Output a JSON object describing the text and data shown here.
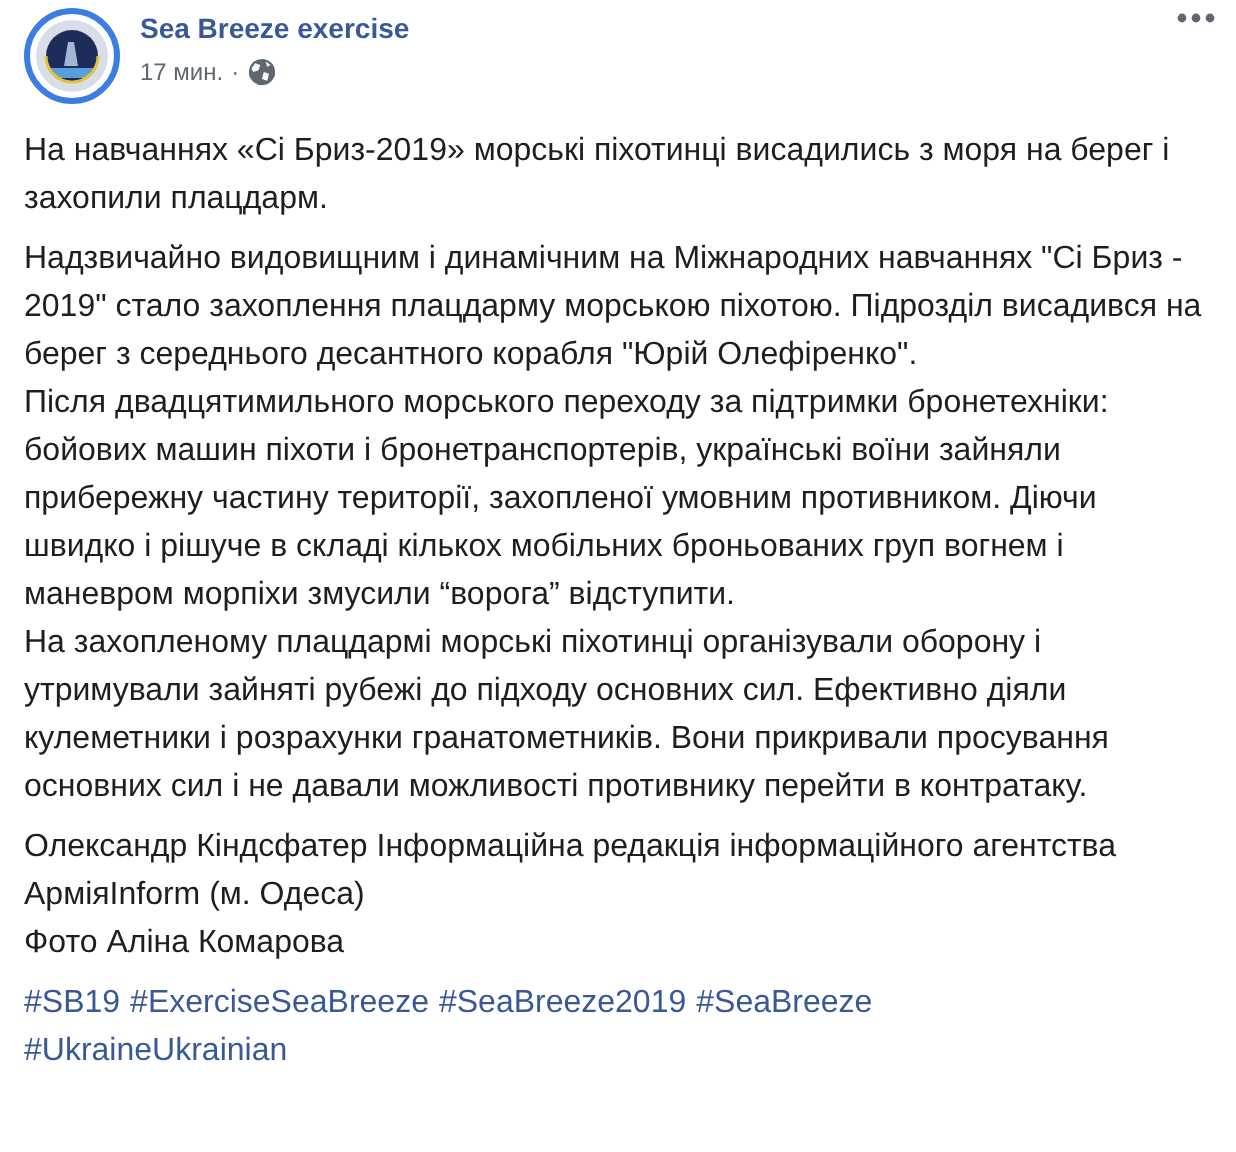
{
  "post": {
    "author": "Sea Breeze exercise",
    "time": "17 мин.",
    "separator": "·"
  },
  "paragraphs": [
    [
      "На навчаннях «Сі Бриз-2019» морські піхотинці висадились з моря на берег і захопили плацдарм."
    ],
    [
      "Надзвичайно видовищним і динамічним на Міжнародних навчаннях \"Сі Бриз - 2019\" стало захоплення плацдарму морською піхотою. Підрозділ висадився на берег з середнього десантного корабля \"Юрій Олефіренко\".",
      "Після двадцятимильного морського переходу за підтримки бронетехніки: бойових машин піхоти і бронетранспортерів, українські воїни зайняли прибережну частину території, захопленої умовним противником. Діючи швидко і рішуче в складі кількох мобільних броньованих груп вогнем і маневром морпіхи змусили “ворога” відступити.",
      "На захопленому плацдармі морські піхотинці організували оборону і утримували зайняті рубежі до підходу основних сил. Ефективно діяли кулеметники і розрахунки гранатометників. Вони прикривали просування основних сил і не давали можливості противнику перейти в контратаку."
    ],
    [
      "Олександр Кіндсфатер Інформаційна редакція інформаційного агентства АрміяInform (м. Одеса)",
      "Фото Аліна Комарова"
    ]
  ],
  "hashtags": [
    "#SB19",
    "#ExerciseSeaBreeze",
    "#SeaBreeze2019",
    "#SeaBreeze",
    "#UkraineUkrainian"
  ]
}
